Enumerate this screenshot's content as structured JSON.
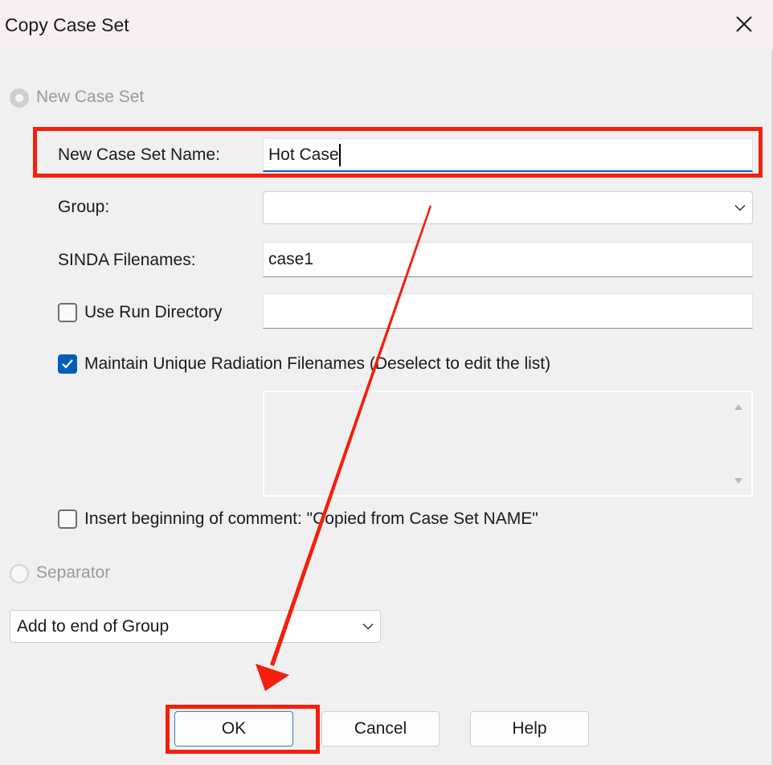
{
  "window": {
    "title": "Copy Case Set",
    "close_icon": "close-icon"
  },
  "form": {
    "new_case_set_option": {
      "label": "New Case Set",
      "selected": true,
      "enabled": false
    },
    "new_case_set_name": {
      "label": "New Case Set Name:",
      "value": "Hot Case"
    },
    "group": {
      "label": "Group:",
      "value": ""
    },
    "sinda_filenames": {
      "label": "SINDA Filenames:",
      "value": "case1"
    },
    "use_run_directory": {
      "label": "Use Run Directory",
      "checked": false,
      "value": ""
    },
    "maintain_unique": {
      "label": "Maintain Unique Radiation Filenames (Deselect to edit the list)",
      "checked": true
    },
    "radiation_filenames_list": [],
    "insert_comment": {
      "label": "Insert beginning of comment: \"Copied from Case Set NAME\"",
      "checked": false
    },
    "separator_option": {
      "label": "Separator",
      "selected": false,
      "enabled": false
    },
    "position": {
      "value": "Add to end of Group"
    }
  },
  "buttons": {
    "ok": "OK",
    "cancel": "Cancel",
    "help": "Help"
  },
  "annotation": {
    "color": "#f41f0c",
    "highlights": [
      "new-case-set-name-row",
      "ok-button"
    ],
    "arrow": "from name field to OK button"
  }
}
